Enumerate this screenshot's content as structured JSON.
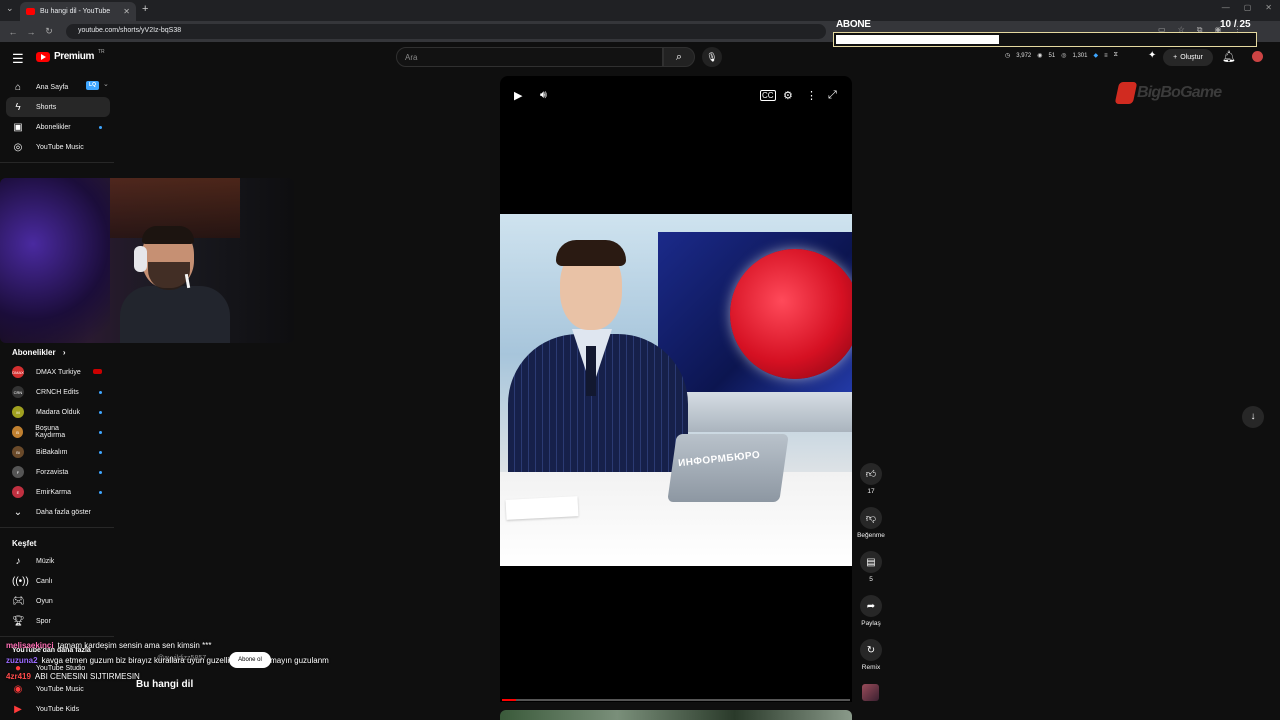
{
  "browser": {
    "tab_title": "Bu hangi dil - YouTube",
    "new_tab": "+",
    "url": "youtube.com/shorts/yV2Iz-bqS38"
  },
  "stream_overlay": {
    "sub_goal_label": "ABONE",
    "sub_goal_count": "10 / 25",
    "sub_goal_progress": 0.39
  },
  "header": {
    "logo_text": "Premium",
    "logo_suffix": "TR",
    "search_placeholder": "Ara",
    "stats": [
      "3,972",
      "51",
      "1,301"
    ],
    "create_label": "Oluştur"
  },
  "sidebar": {
    "main": [
      {
        "label": "Ana Sayfa",
        "icon": "home-icon"
      },
      {
        "label": "Shorts",
        "icon": "shorts-icon"
      },
      {
        "label": "Abonelikler",
        "icon": "subscriptions-icon"
      },
      {
        "label": "YouTube Music",
        "icon": "music-icon"
      }
    ],
    "lq_badge": "LQ",
    "subs_title": "Abonelikler",
    "subscriptions": [
      {
        "label": "DMAX Turkiye",
        "avatar_text": "DMAX",
        "avatar_color": "#d32f2f"
      },
      {
        "label": "CRNCH Edits",
        "avatar_text": "CRN",
        "avatar_color": "#333333"
      },
      {
        "label": "Madara Olduk",
        "avatar_text": "M",
        "avatar_color": "#a0a020"
      },
      {
        "label": "Boşuna Kaydırma",
        "avatar_text": "B",
        "avatar_color": "#c08030"
      },
      {
        "label": "BiBakalım",
        "avatar_text": "Bi",
        "avatar_color": "#6a4a2a"
      },
      {
        "label": "Forzavista",
        "avatar_text": "F",
        "avatar_color": "#555555"
      },
      {
        "label": "EmirKarma",
        "avatar_text": "E",
        "avatar_color": "#c03040"
      }
    ],
    "show_more": "Daha fazla göster",
    "explore_title": "Keşfet",
    "explore": [
      {
        "label": "Müzik",
        "icon": "music-note-icon"
      },
      {
        "label": "Canlı",
        "icon": "live-icon"
      },
      {
        "label": "Oyun",
        "icon": "gaming-icon"
      },
      {
        "label": "Spor",
        "icon": "trophy-icon"
      }
    ],
    "more_from_youtube": "YouTube'dan daha fazla",
    "more": [
      {
        "label": "YouTube Studio"
      },
      {
        "label": "YouTube Music"
      },
      {
        "label": "YouTube Kids"
      }
    ]
  },
  "video": {
    "laptop_text": "ИНФОРМБЮРО",
    "progress": 0.04,
    "title": "Bu hangi dil"
  },
  "actions": {
    "likes": "17",
    "dislike_label": "Beğenme",
    "comments": "5",
    "share_label": "Paylaş",
    "remix_label": "Remix"
  },
  "sponsor": {
    "name": "BigBoGame"
  },
  "chat": [
    {
      "user": "melisaekinci",
      "user_color": "#ff6fb5",
      "text": "tamam kardeşim sensin ama sen kimsin ***"
    },
    {
      "user": "zuzuna2",
      "user_color": "#9b6bff",
      "text": "kavga etmen guzum biz birayız kurallara uyun guzelliklerim yaoamayın guzulanm"
    },
    {
      "user": "4zr419",
      "user_color": "#ff4b4b",
      "text": "ABI CENESINI SIJTIRMESIN"
    }
  ],
  "chat_extra": {
    "abone_pill": "Abone ol",
    "ghost_name": "@ayyildizz5857"
  }
}
